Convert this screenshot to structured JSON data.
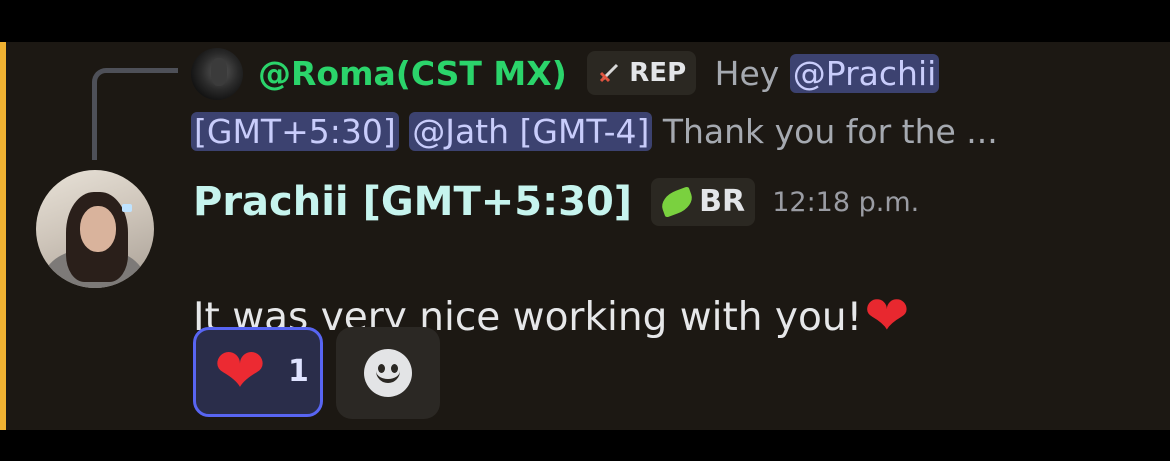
{
  "reply": {
    "author": "@Roma(CST MX)",
    "role_tag": {
      "icon": "sword-icon",
      "label": "REP"
    },
    "text_prefix": "Hey",
    "mentions": [
      "@Prachii [GMT+5:30]",
      "@Jath [GMT-4]"
    ],
    "mention_1_part1": "@Prachii",
    "mention_1_part2": "[GMT+5:30]",
    "text_suffix": "Thank you for the ..."
  },
  "message": {
    "author": "Prachii [GMT+5:30]",
    "role_tag": {
      "icon": "leaf-icon",
      "label": "BR"
    },
    "timestamp": "12:18 p.m.",
    "body": "It was very nice working with you!",
    "body_emoji": "heart-emoji"
  },
  "reactions": [
    {
      "emoji": "heart-emoji",
      "count": "1",
      "selected": true
    }
  ],
  "colors": {
    "background": "#1c1813",
    "highlight_bar": "#f0b232",
    "reply_author": "#2bd46b",
    "message_author": "#c6f4ee",
    "mention_bg": "#3c4270",
    "reaction_border": "#5865f2"
  }
}
